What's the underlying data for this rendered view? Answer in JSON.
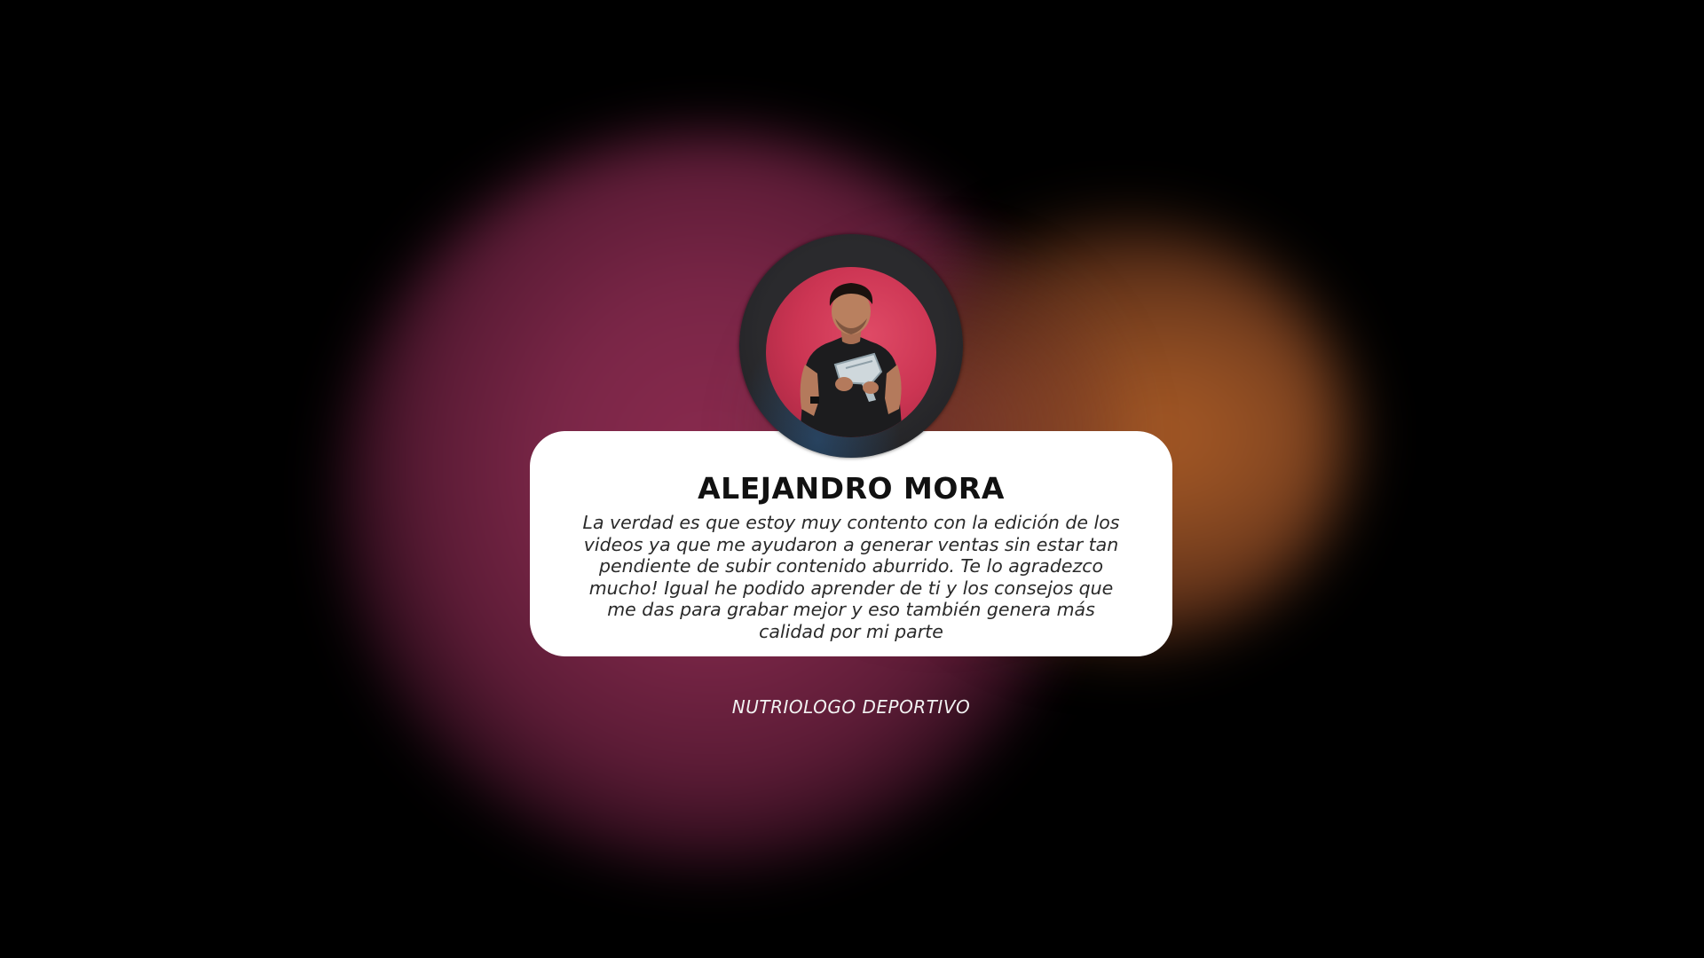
{
  "testimonial": {
    "name": "ALEJANDRO MORA",
    "quote": "La verdad es que estoy muy contento con la edición de los videos ya que me ayudaron a generar ventas sin estar tan pendiente de subir contenido aburrido. Te lo agradezco mucho! Igual he podido aprender de ti y los consejos que me das para grabar mejor y eso también genera más calidad por mi parte",
    "role": "NUTRIOLOGO DEPORTIVO"
  },
  "colors": {
    "background": "#000000",
    "glow_magenta": "#8a2a4e",
    "glow_orange": "#a85a25",
    "card": "#ffffff",
    "avatar_ring": "#2a2a2d",
    "photo_backdrop": "#d23a58"
  }
}
